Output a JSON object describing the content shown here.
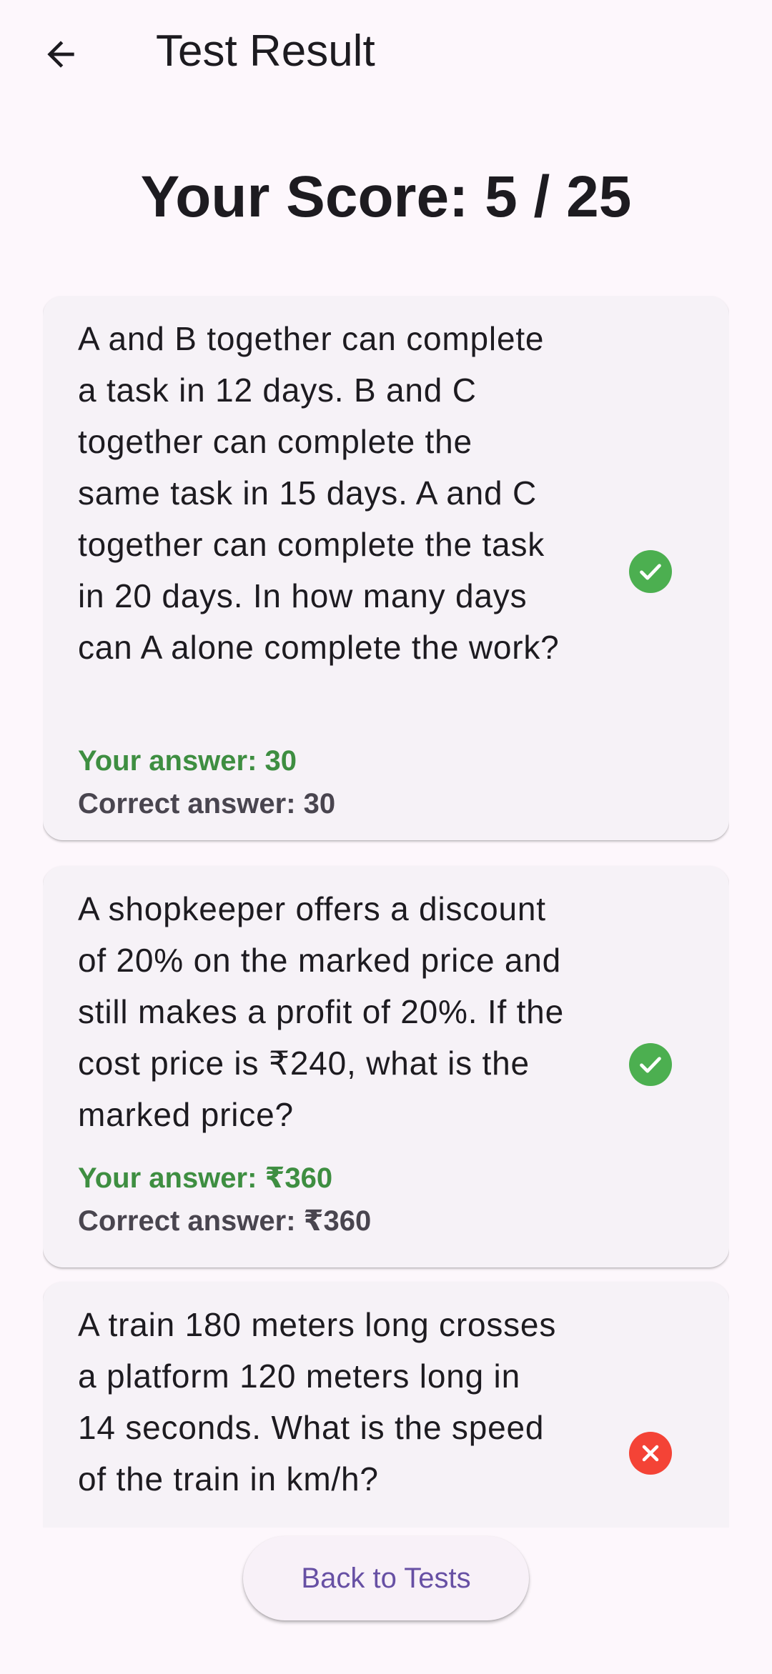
{
  "appbar": {
    "title": "Test Result",
    "back_icon": "arrow-left-icon"
  },
  "score": {
    "label": "Your Score: 5 / 25"
  },
  "results": [
    {
      "question": "A and B together can complete a task in 12 days. B and C together can complete the same task in 15 days. A and C together can complete the task in 20 days. In how many days can A alone complete the work?",
      "your_answer": "Your answer: 30",
      "correct_answer": "Correct answer: 30",
      "status": "correct",
      "status_icon": "check-circle-icon"
    },
    {
      "question": "A shopkeeper offers a discount of 20% on the marked price and still makes a profit of 20%. If the cost price is ₹240, what is the marked price?",
      "your_answer": "Your answer: ₹360",
      "correct_answer": "Correct answer: ₹360",
      "status": "correct",
      "status_icon": "check-circle-icon"
    },
    {
      "question": "A train 180 meters long crosses a platform 120 meters long in 14 seconds. What is the speed of the train in km/h?",
      "status": "incorrect",
      "status_icon": "cross-circle-icon"
    }
  ],
  "footer": {
    "back_button_label": "Back to Tests"
  },
  "colors": {
    "background": "#fdf7fc",
    "card": "#f6f2f7",
    "correct_green": "#4caf50",
    "answer_green": "#3e8e41",
    "incorrect_red": "#f44336",
    "primary": "#6750a4"
  }
}
